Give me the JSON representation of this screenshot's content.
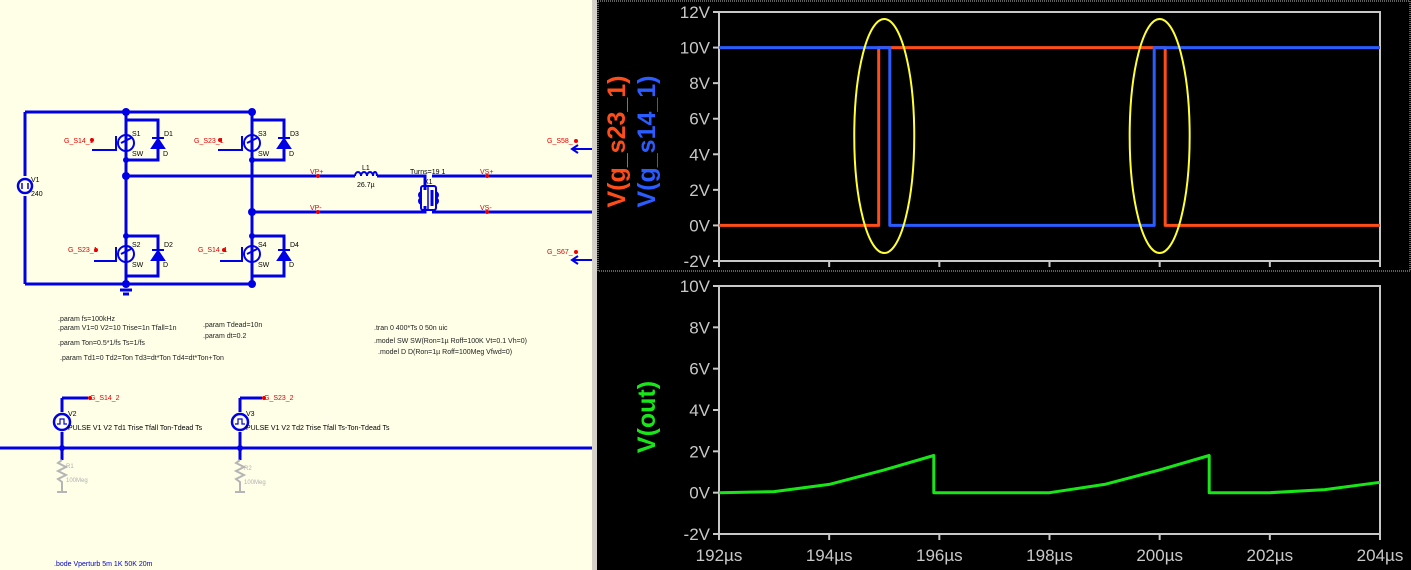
{
  "schematic": {
    "net_labels": {
      "g_s14_a": "G_S14_1",
      "g_s23_a": "G_S23_1",
      "g_s23_b": "G_S23_1",
      "g_s14_b": "G_S14_1",
      "g_s58": "G_S58_",
      "g_s67": "G_S67_",
      "g_s14_2": "G_S14_2",
      "g_s23_2": "G_S23_2",
      "vp_plus": "VP+",
      "vp_minus": "VP-",
      "vs_plus": "VS+",
      "vs_minus": "VS-"
    },
    "components": {
      "s1": "S1",
      "s2": "S2",
      "s3": "S3",
      "s4": "S4",
      "d1": "D1",
      "d2": "D2",
      "d3": "D3",
      "d4": "D4",
      "sw": "SW",
      "d": "D",
      "v1": "V1",
      "v1_value": "240",
      "l1": "L1",
      "l1_value": "26.7µ",
      "x1": "X1",
      "turns": "Turns=19 1",
      "v2": "V2",
      "v3": "V3",
      "r1": "R1",
      "r1_value": "100Meg",
      "r2": "R2",
      "r2_value": "100Meg",
      "v2_pulse": "PULSE V1 V2 Td1 Trise Tfall Ton-Tdead Ts",
      "v3_pulse": "PULSE V1 V2 Td2 Trise Tfall Ts-Ton-Tdead Ts"
    },
    "directives": {
      "param_fs": ".param fs=100kHz",
      "param_v": ".param V1=0 V2=10 Trise=1n Tfall=1n",
      "param_ton": ".param Ton=0.5*1/fs Ts=1/fs",
      "param_td": ".param Td1=0 Td2=Ton Td3=dt*Ton Td4=dt*Ton+Ton",
      "param_tdead": ".param Tdead=10n",
      "param_dt": ".param dt=0.2",
      "tran": ".tran 0 400*Ts 0 50n uic",
      "model_sw": ".model SW SW(Ron=1µ Roff=100K Vt=0.1 Vh=0)",
      "model_d": ".model D D(Ron=1µ Roff=100Meg Vfwd=0)",
      "bode": ".bode Vperturb 5m 1K 50K 20m"
    }
  },
  "waveform": {
    "colors": {
      "s23": "#ff4d1a",
      "s14": "#2a5cff",
      "out": "#19e619",
      "highlight": "#ffff33",
      "axis": "#c8c8c8"
    },
    "chart_data": [
      {
        "type": "line",
        "name": "top-pane",
        "x_unit": "µs",
        "xlim": [
          192,
          204
        ],
        "ylim": [
          -2,
          12
        ],
        "y_ticks": [
          "12V",
          "10V",
          "8V",
          "6V",
          "4V",
          "2V",
          "0V",
          "-2V"
        ],
        "series": [
          {
            "name": "V(g_s23_1)",
            "x": [
              192,
              194.9,
              194.9,
              200.1,
              200.1,
              204
            ],
            "y": [
              0,
              0,
              10,
              10,
              0,
              0
            ]
          },
          {
            "name": "V(g_s14_1)",
            "x": [
              192,
              195.1,
              195.1,
              199.9,
              199.9,
              204
            ],
            "y": [
              10,
              10,
              0,
              0,
              10,
              10
            ]
          }
        ]
      },
      {
        "type": "line",
        "name": "bottom-pane",
        "x_unit": "µs",
        "xlim": [
          192,
          204
        ],
        "ylim": [
          -2,
          10
        ],
        "y_ticks": [
          "10V",
          "8V",
          "6V",
          "4V",
          "2V",
          "0V",
          "-2V"
        ],
        "x_ticks": [
          "192µs",
          "194µs",
          "196µs",
          "198µs",
          "200µs",
          "202µs",
          "204µs"
        ],
        "series": [
          {
            "name": "V(out)",
            "x": [
              192,
              193,
              194,
              195,
              195.9,
              195.9,
              196.5,
              197,
              198,
              199,
              200,
              200.9,
              200.9,
              201.5,
              202,
              203,
              204
            ],
            "y": [
              0,
              0.05,
              0.4,
              1.1,
              1.8,
              0,
              0,
              0,
              0,
              0.4,
              1.1,
              1.8,
              0,
              0,
              0,
              0.15,
              0.5
            ]
          }
        ]
      }
    ]
  }
}
